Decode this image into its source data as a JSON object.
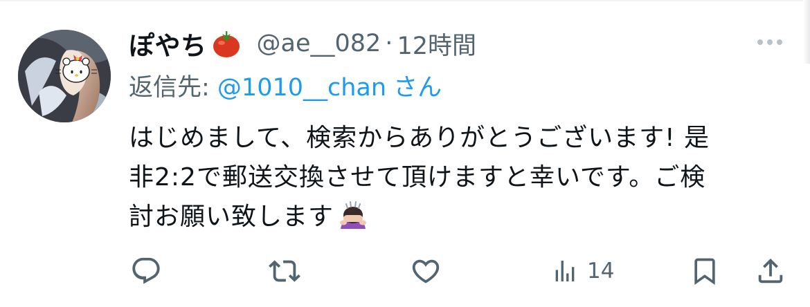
{
  "tweet": {
    "display_name": "ぽやち",
    "display_name_emoji": "tomato-emoji",
    "handle": "@ae__082",
    "separator": "·",
    "time": "12時間",
    "reply_prefix": "返信先: ",
    "reply_target": "@1010__chan",
    "reply_suffix": "さん",
    "body_lines": [
      "はじめまして、検索からありがとうございます! 是",
      "非2:2で郵送交換させて頂けますと幸いです。ご検",
      "討お願い致します"
    ],
    "body_trailing_emoji": "person-bowing-emoji"
  },
  "actions": {
    "reply_icon": "reply-icon",
    "retweet_icon": "retweet-icon",
    "like_icon": "heart-icon",
    "views_icon": "views-icon",
    "views_count": "14",
    "bookmark_icon": "bookmark-icon",
    "share_icon": "share-icon"
  },
  "colors": {
    "text_primary": "#0f1419",
    "text_secondary": "#536471",
    "link": "#1d9bf0"
  }
}
